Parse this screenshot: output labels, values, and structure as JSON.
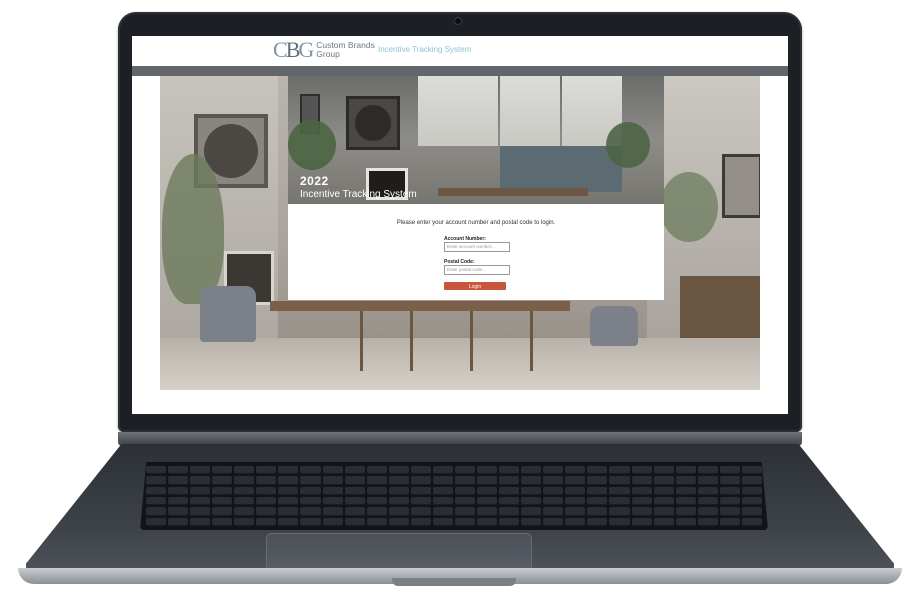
{
  "site": {
    "logo_mark_c": "C",
    "logo_mark_b": "B",
    "logo_mark_g": "G",
    "logo_line1": "Custom Brands",
    "logo_line2": "Group",
    "subtitle": "Incentive Tracking System"
  },
  "hero": {
    "year": "2022",
    "title": "Incentive Tracking System"
  },
  "login": {
    "prompt": "Please enter your account number and postal code to login.",
    "account_label": "Account Number:",
    "account_placeholder": "Enter account number...",
    "postal_label": "Postal Code:",
    "postal_placeholder": "Enter postal code...",
    "button_label": "Login"
  },
  "colors": {
    "accent": "#c8553c",
    "subtitle": "#8fc3d4",
    "header_band": "#62666b"
  }
}
